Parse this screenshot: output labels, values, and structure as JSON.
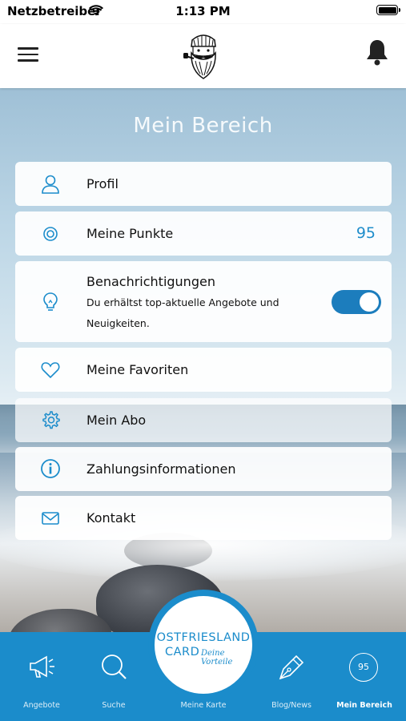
{
  "status_bar": {
    "carrier": "Netzbetreiber",
    "time": "1:13 PM"
  },
  "header": {
    "menu_icon": "hamburger-menu-icon",
    "logo_icon": "bearded-sailor-logo",
    "bell_icon": "bell-icon"
  },
  "page": {
    "title": "Mein Bereich"
  },
  "items": [
    {
      "label": "Profil",
      "icon": "user-icon"
    },
    {
      "label": "Meine Punkte",
      "icon": "target-icon",
      "value": "95"
    },
    {
      "label": "Benachrichtigungen",
      "icon": "lightbulb-icon",
      "description": "Du erhältst top-aktuelle Angebote und Neuigkeiten.",
      "toggle_on": true
    },
    {
      "label": "Meine Favoriten",
      "icon": "heart-icon"
    },
    {
      "label": "Mein Abo",
      "icon": "gear-icon"
    },
    {
      "label": "Zahlungsinformationen",
      "icon": "info-icon"
    },
    {
      "label": "Kontakt",
      "icon": "envelope-icon"
    }
  ],
  "tabbar": {
    "tabs": [
      {
        "label": "Angebote",
        "icon": "megaphone-icon"
      },
      {
        "label": "Suche",
        "icon": "search-icon"
      },
      {
        "label": "Meine Karte",
        "icon": "card-logo"
      },
      {
        "label": "Blog/News",
        "icon": "pen-nib-icon"
      },
      {
        "label": "Mein Bereich",
        "icon": "points-badge",
        "badge": "95"
      }
    ],
    "center_logo": {
      "line1": "OSTFRIESLAND",
      "line2": "CARD",
      "line3": "Deine Vorteile"
    },
    "active_tab": "Mein Bereich"
  },
  "colors": {
    "accent": "#1b8ccb",
    "toggle": "#1c7dbd"
  }
}
